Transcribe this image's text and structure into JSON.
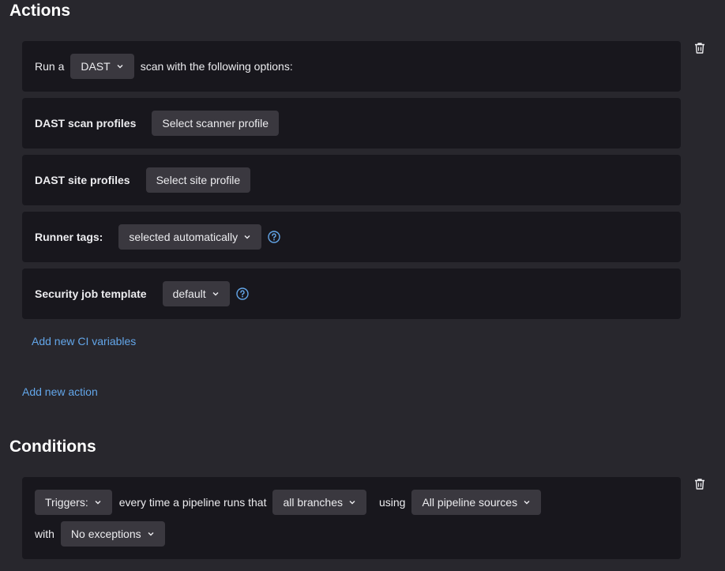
{
  "actions": {
    "title": "Actions",
    "run_prefix": "Run a",
    "scan_type": "DAST",
    "run_suffix": "scan with the following options:",
    "scan_profiles_label": "DAST scan profiles",
    "scan_profiles_button": "Select scanner profile",
    "site_profiles_label": "DAST site profiles",
    "site_profiles_button": "Select site profile",
    "runner_tags_label": "Runner tags:",
    "runner_tags_value": "selected automatically",
    "job_template_label": "Security job template",
    "job_template_value": "default",
    "add_ci_variables": "Add new CI variables",
    "add_action": "Add new action"
  },
  "conditions": {
    "title": "Conditions",
    "triggers_value": "Triggers:",
    "every_time_text": "every time a pipeline runs that",
    "branches_value": "all branches",
    "using_text": "using",
    "sources_value": "All pipeline sources",
    "with_text": "with",
    "exceptions_value": "No exceptions"
  },
  "colors": {
    "background": "#28272d",
    "card": "#18171d",
    "button": "#3a383f",
    "link": "#63a6e9"
  }
}
